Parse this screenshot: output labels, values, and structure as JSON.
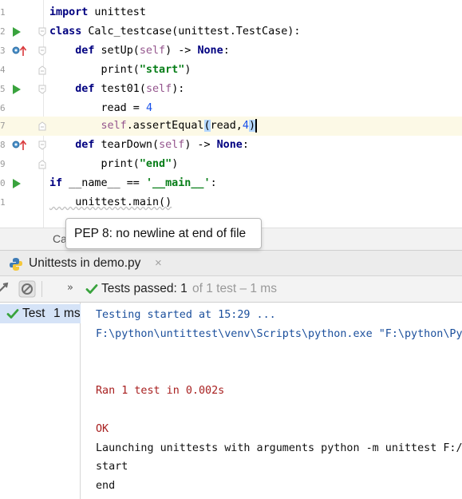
{
  "editor": {
    "line_numbers": [
      "1",
      "2",
      "3",
      "4",
      "5",
      "6",
      "7",
      "8",
      "9",
      "0",
      "1"
    ],
    "lines": [
      {
        "segments": [
          {
            "t": "import",
            "c": "kw"
          },
          {
            "t": " unittest",
            "c": ""
          }
        ]
      },
      {
        "segments": [
          {
            "t": "class",
            "c": "kw"
          },
          {
            "t": " Calc_testcase(unittest.TestCase):",
            "c": ""
          }
        ]
      },
      {
        "segments": [
          {
            "t": "    "
          },
          {
            "t": "def",
            "c": "kw"
          },
          {
            "t": " setUp(",
            "c": ""
          },
          {
            "t": "self",
            "c": "self"
          },
          {
            "t": ") -> ",
            "c": ""
          },
          {
            "t": "None",
            "c": "kw"
          },
          {
            "t": ":",
            "c": ""
          }
        ]
      },
      {
        "segments": [
          {
            "t": "        print(",
            "c": ""
          },
          {
            "t": "\"start\"",
            "c": "str"
          },
          {
            "t": ")",
            "c": ""
          }
        ]
      },
      {
        "segments": [
          {
            "t": "    "
          },
          {
            "t": "def",
            "c": "kw"
          },
          {
            "t": " test01(",
            "c": ""
          },
          {
            "t": "self",
            "c": "self"
          },
          {
            "t": "):",
            "c": ""
          }
        ]
      },
      {
        "segments": [
          {
            "t": "        read = ",
            "c": ""
          },
          {
            "t": "4",
            "c": "num"
          }
        ]
      },
      {
        "segments": [
          {
            "t": "        "
          },
          {
            "t": "self",
            "c": "self"
          },
          {
            "t": ".assertEqual",
            "c": ""
          },
          {
            "t": "(",
            "c": "paren-match"
          },
          {
            "t": "read,",
            "c": ""
          },
          {
            "t": "4",
            "c": "num"
          },
          {
            "t": ")",
            "c": "paren-match"
          }
        ]
      },
      {
        "segments": [
          {
            "t": "    "
          },
          {
            "t": "def",
            "c": "kw"
          },
          {
            "t": " tearDown(",
            "c": ""
          },
          {
            "t": "self",
            "c": "self"
          },
          {
            "t": ") -> ",
            "c": ""
          },
          {
            "t": "None",
            "c": "kw"
          },
          {
            "t": ":",
            "c": ""
          }
        ]
      },
      {
        "segments": [
          {
            "t": "        print(",
            "c": ""
          },
          {
            "t": "\"end\"",
            "c": "str"
          },
          {
            "t": ")",
            "c": ""
          }
        ]
      },
      {
        "segments": [
          {
            "t": "if",
            "c": "kw"
          },
          {
            "t": " __name__ == ",
            "c": ""
          },
          {
            "t": "'__main__'",
            "c": "str"
          },
          {
            "t": ":",
            "c": ""
          }
        ]
      },
      {
        "segments": [
          {
            "t": "    unittest.main()",
            "c": ""
          }
        ]
      }
    ]
  },
  "tooltip": {
    "text": "PEP 8: no newline at end of file"
  },
  "breadcrumb": {
    "text": "Ca"
  },
  "run_window": {
    "tab_label": "Unittests in demo.py",
    "tab_close": "×",
    "expand_glyph": "»",
    "tests_passed_label": "Tests passed:",
    "tests_passed_value": "1",
    "tests_count_text": "of 1 test – 1 ms",
    "tree_label": "Test",
    "tree_time": "1 ms",
    "console": [
      {
        "text": "Testing started at 15:29 ...",
        "color": "blue"
      },
      {
        "text": "F:\\python\\untittest\\venv\\Scripts\\python.exe \"F:\\python\\PyC",
        "color": "blue"
      },
      {
        "text": "",
        "color": "black"
      },
      {
        "text": "",
        "color": "black"
      },
      {
        "text": "Ran 1 test in 0.002s",
        "color": "red"
      },
      {
        "text": "",
        "color": "black"
      },
      {
        "text": "OK",
        "color": "red"
      },
      {
        "text": "Launching unittests with arguments python -m unittest F:/p",
        "color": "black"
      },
      {
        "text": "start",
        "color": "black"
      },
      {
        "text": "end",
        "color": "black"
      }
    ]
  },
  "colors": {
    "run_green": "#39a33d",
    "keyword_navy": "#000080",
    "string_green": "#067d17",
    "self_purple": "#94558d",
    "number_blue": "#1750eb",
    "console_blue": "#1b4f9c",
    "console_red": "#a82020",
    "current_line": "#fcf9e6",
    "selection_blue": "#d5e3f7"
  },
  "icons": [
    "run-icon",
    "override-icon",
    "fold-icon",
    "python-icon",
    "rerun-icon",
    "stop-icon",
    "check-icon"
  ]
}
